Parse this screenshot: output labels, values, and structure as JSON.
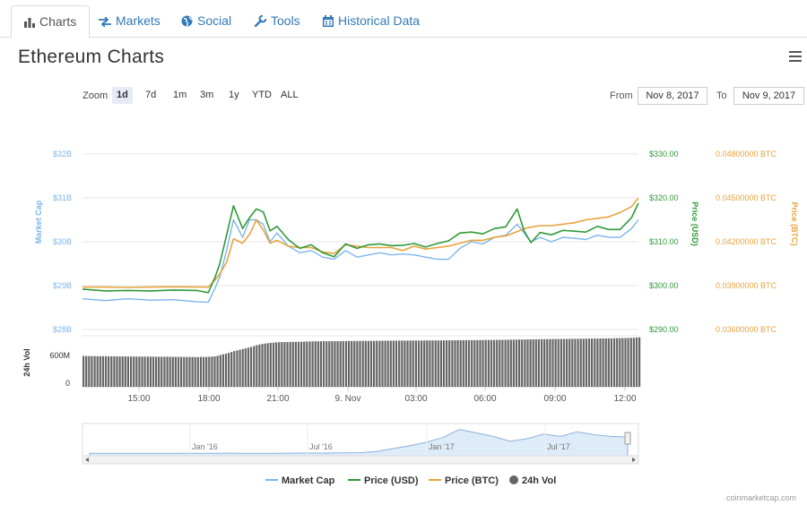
{
  "tabs": [
    {
      "label": "Charts",
      "icon": "bar-chart-icon"
    },
    {
      "label": "Markets",
      "icon": "exchange-icon"
    },
    {
      "label": "Social",
      "icon": "globe-icon"
    },
    {
      "label": "Tools",
      "icon": "wrench-icon"
    },
    {
      "label": "Historical Data",
      "icon": "calendar-icon"
    }
  ],
  "title": "Ethereum Charts",
  "zoom": {
    "label": "Zoom",
    "options": [
      "1d",
      "7d",
      "1m",
      "3m",
      "1y",
      "YTD",
      "ALL"
    ],
    "selected": "1d"
  },
  "range": {
    "from_label": "From",
    "from": "Nov 8, 2017",
    "to_label": "To",
    "to": "Nov 9, 2017"
  },
  "chart_data": {
    "type": "line",
    "x_tick_labels": [
      "15:00",
      "18:00",
      "21:00",
      "9. Nov",
      "03:00",
      "06:00",
      "09:00",
      "12:00"
    ],
    "axes": {
      "market_cap": {
        "title": "Market Cap",
        "ticks": [
          "$32B",
          "$31B",
          "$30B",
          "$29B",
          "$28B"
        ],
        "color": "#7cb5ec"
      },
      "price_usd": {
        "title": "Price (USD)",
        "ticks": [
          "$330.00",
          "$320.00",
          "$310.00",
          "$300.00",
          "$290.00"
        ],
        "color": "#2f9a3a"
      },
      "price_btc": {
        "title": "Price (BTC)",
        "ticks": [
          "0.04800000 BTC",
          "0.04500000 BTC",
          "0.04200000 BTC",
          "0.03900000 BTC",
          "0.03600000 BTC"
        ],
        "color": "#e8a33d"
      },
      "volume": {
        "title": "24h Vol",
        "ticks": [
          "600M",
          "0"
        ]
      }
    },
    "x_hours_from_start": [
      0,
      1,
      2,
      3,
      4,
      5,
      5.5,
      5.8,
      6,
      6.3,
      6.6,
      7,
      7.3,
      7.6,
      7.9,
      8.2,
      8.5,
      9,
      9.5,
      10,
      10.5,
      11,
      11.5,
      12,
      12.5,
      13,
      13.5,
      14,
      14.5,
      15,
      15.5,
      16,
      16.5,
      17,
      17.5,
      18,
      18.5,
      19,
      19.3,
      19.6,
      20,
      20.5,
      21,
      21.5,
      22,
      22.5,
      23,
      23.5,
      24,
      24.3
    ],
    "series": [
      {
        "name": "Market Cap",
        "unit": "USD billions",
        "values": [
          28.7,
          28.66,
          28.7,
          28.67,
          28.68,
          28.63,
          28.62,
          28.95,
          29.2,
          29.8,
          30.5,
          30.1,
          30.5,
          30.5,
          30.4,
          30.0,
          30.2,
          29.9,
          29.75,
          29.8,
          29.65,
          29.6,
          29.8,
          29.65,
          29.7,
          29.75,
          29.7,
          29.72,
          29.7,
          29.65,
          29.6,
          29.6,
          29.85,
          30.0,
          29.95,
          30.1,
          30.15,
          30.4,
          30.2,
          30.0,
          30.1,
          30.0,
          30.1,
          30.08,
          30.05,
          30.15,
          30.1,
          30.1,
          30.3,
          30.5
        ]
      },
      {
        "name": "Price (USD)",
        "unit": "USD",
        "values": [
          299.2,
          298.8,
          298.9,
          298.8,
          299.0,
          298.9,
          298.4,
          302.0,
          305.0,
          311.5,
          318.2,
          313.0,
          315.5,
          317.5,
          316.8,
          312.5,
          313.5,
          310.5,
          308.5,
          309.3,
          307.5,
          306.6,
          309.5,
          308.5,
          309.3,
          309.5,
          309.1,
          309.2,
          309.6,
          308.8,
          309.6,
          310.2,
          312.0,
          312.2,
          311.8,
          313.0,
          313.4,
          317.5,
          312.5,
          309.8,
          312.1,
          311.6,
          312.6,
          312.4,
          312.2,
          313.5,
          312.8,
          312.8,
          315.5,
          318.8
        ]
      },
      {
        "name": "Price (BTC)",
        "unit": "BTC",
        "values": [
          0.0389,
          0.0389,
          0.03888,
          0.0389,
          0.03892,
          0.0389,
          0.0389,
          0.0394,
          0.0398,
          0.0406,
          0.0422,
          0.0419,
          0.0425,
          0.0435,
          0.0428,
          0.0419,
          0.0421,
          0.0417,
          0.0416,
          0.0416,
          0.0413,
          0.0412,
          0.0418,
          0.0417,
          0.0416,
          0.0416,
          0.0416,
          0.0414,
          0.0417,
          0.0415,
          0.0416,
          0.0417,
          0.0419,
          0.0421,
          0.0421,
          0.0423,
          0.0424,
          0.0427,
          0.0429,
          0.043,
          0.0431,
          0.0431,
          0.0432,
          0.0433,
          0.0435,
          0.0436,
          0.0437,
          0.044,
          0.0444,
          0.045
        ]
      },
      {
        "name": "24h Vol",
        "unit": "USD millions",
        "values": [
          560,
          555,
          550,
          548,
          545,
          540,
          545,
          555,
          580,
          610,
          650,
          690,
          720,
          760,
          785,
          800,
          810,
          815,
          820,
          825,
          828,
          830,
          832,
          834,
          835,
          836,
          838,
          840,
          841,
          842,
          843,
          845,
          846,
          848,
          850,
          852,
          855,
          858,
          860,
          862,
          865,
          868,
          870,
          872,
          875,
          878,
          880,
          885,
          890,
          900
        ]
      }
    ],
    "navigator": {
      "tick_labels": [
        "Jan '16",
        "Jul '16",
        "Jan '17",
        "Jul '17"
      ],
      "trend": [
        1,
        1,
        1,
        1,
        1.1,
        1.2,
        1.3,
        1.2,
        1.4,
        1.3,
        1.2,
        1.3,
        1.4,
        1.5,
        1.6,
        1.8,
        2.2,
        4,
        9,
        14,
        20,
        28,
        42,
        36,
        30,
        22,
        26,
        34,
        30,
        38,
        33,
        30,
        29
      ]
    }
  },
  "legend": [
    {
      "label": "Market Cap",
      "color": "#7cb5ec",
      "style": "line"
    },
    {
      "label": "Price (USD)",
      "color": "#2f9a3a",
      "style": "line"
    },
    {
      "label": "Price (BTC)",
      "color": "#e8a33d",
      "style": "line"
    },
    {
      "label": "24h Vol",
      "color": "#666666",
      "style": "dot"
    }
  ],
  "credit": "coinmarketcap.com"
}
